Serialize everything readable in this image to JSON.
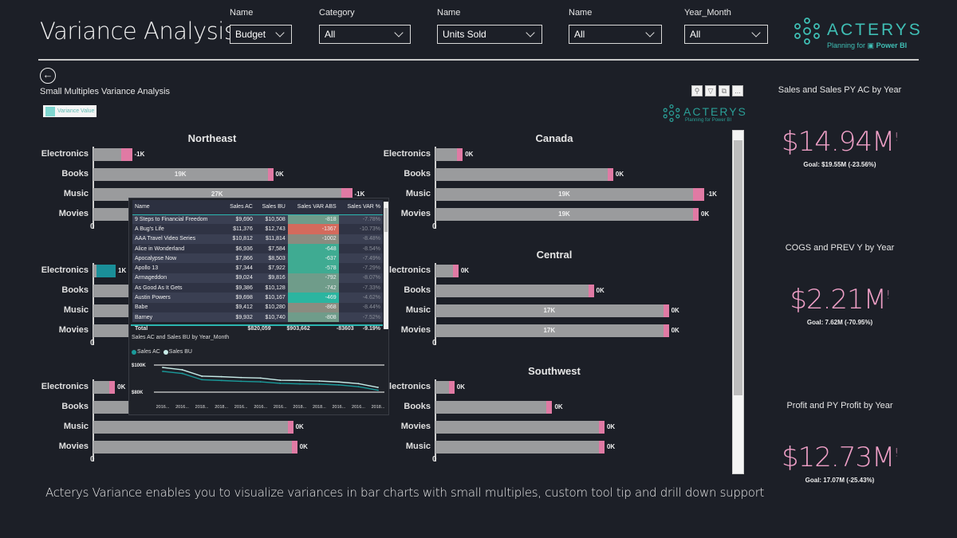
{
  "header": {
    "title": "Variance Analysis",
    "slicers": [
      {
        "label": "Name",
        "value": "Budget"
      },
      {
        "label": "Category",
        "value": "All"
      },
      {
        "label": "Name",
        "value": "Units Sold"
      },
      {
        "label": "Name",
        "value": "All"
      },
      {
        "label": "Year_Month",
        "value": "All"
      }
    ],
    "logo": {
      "name": "ACTERYS",
      "tagline_prefix": "Planning for",
      "tagline_product": "Power BI"
    }
  },
  "visual": {
    "title": "Small Multiples Variance Analysis",
    "legend": "Variance Value",
    "legend_color": "#7fd6cf",
    "toolbar_icons": [
      "pin-icon",
      "filter-icon",
      "focus-mode-icon",
      "more-options-icon"
    ],
    "more_label": "...",
    "watermark": {
      "name": "ACTERYS",
      "tagline": "Planning for Power BI"
    },
    "zero_label": "0",
    "colors": {
      "bar": "#9a9b9d",
      "negative_variance": "#e07aa4",
      "positive_variance": "#1a8f99"
    },
    "multiples": [
      {
        "title": "Northeast",
        "rows": [
          {
            "cat": "Electronics",
            "value": 3,
            "var_label": "-1K"
          },
          {
            "cat": "Books",
            "value": 19,
            "label": "19K",
            "var_label": "0K"
          },
          {
            "cat": "Music",
            "value": 27,
            "label": "27K",
            "var_label": "-1K"
          },
          {
            "cat": "Movies",
            "value": 20
          }
        ]
      },
      {
        "title": "Canada",
        "rows": [
          {
            "cat": "Electronics",
            "value": 1.6,
            "var_label": "0K"
          },
          {
            "cat": "Books",
            "value": 12.7,
            "var_label": "0K"
          },
          {
            "cat": "Music",
            "value": 19,
            "label": "19K",
            "var_label": "-1K"
          },
          {
            "cat": "Movies",
            "value": 19,
            "label": "19K",
            "var_label": "0K"
          }
        ]
      },
      {
        "title": "",
        "rows": [
          {
            "cat": "Electronics",
            "value": 1.4,
            "var_label": "1K",
            "positive": true
          },
          {
            "cat": "Books",
            "value": 10
          },
          {
            "cat": "Music",
            "value": 10
          },
          {
            "cat": "Movies",
            "value": 10
          }
        ]
      },
      {
        "title": "Central",
        "rows": [
          {
            "cat": "Electronics",
            "value": 1.3,
            "var_label": "0K"
          },
          {
            "cat": "Books",
            "value": 11.4,
            "var_label": "0K"
          },
          {
            "cat": "Music",
            "value": 17,
            "label": "17K",
            "var_label": "0K"
          },
          {
            "cat": "Movies",
            "value": 17,
            "label": "17K",
            "var_label": "0K"
          }
        ]
      },
      {
        "title": "",
        "rows": [
          {
            "cat": "Electronics",
            "value": 1.2,
            "var_label": "0K"
          },
          {
            "cat": "Books",
            "value": 10
          },
          {
            "cat": "Music",
            "value": 14.5,
            "var_label": "0K"
          },
          {
            "cat": "Movies",
            "value": 14.8,
            "var_label": "0K"
          }
        ]
      },
      {
        "title": "Southwest",
        "rows": [
          {
            "cat": "Electronics",
            "value": 1.0,
            "var_label": "0K"
          },
          {
            "cat": "Books",
            "value": 8.3,
            "var_label": "0K"
          },
          {
            "cat": "Movies",
            "value": 12.2,
            "var_label": "0K"
          },
          {
            "cat": "Music",
            "value": 12.2,
            "var_label": "0K"
          }
        ]
      }
    ]
  },
  "tooltip": {
    "table": {
      "columns": [
        "Name",
        "Sales AC",
        "Sales BU",
        "Sales VAR ABS",
        "Sales VAR %"
      ],
      "rows": [
        [
          "9 Steps to Financial Freedom",
          "$9,690",
          "$10,508",
          "-818",
          "-7.78%",
          "#6f9c8a"
        ],
        [
          "A Bug's Life",
          "$11,376",
          "$12,743",
          "-1367",
          "-10.73%",
          "#d46a5c"
        ],
        [
          "AAA Travel Video Series",
          "$10,812",
          "$11,814",
          "-1002",
          "-8.48%",
          "#8a8c80"
        ],
        [
          "Alice in Wonderland",
          "$6,936",
          "$7,584",
          "-648",
          "-8.54%",
          "#3fab92"
        ],
        [
          "Apocalypse Now",
          "$7,866",
          "$8,503",
          "-637",
          "-7.49%",
          "#3fab92"
        ],
        [
          "Apollo 13",
          "$7,344",
          "$7,922",
          "-578",
          "-7.29%",
          "#3fab92"
        ],
        [
          "Armageddon",
          "$9,024",
          "$9,816",
          "-792",
          "-8.07%",
          "#6f9c8a"
        ],
        [
          "As Good As It Gets",
          "$9,386",
          "$10,128",
          "-742",
          "-7.33%",
          "#6f9c8a"
        ],
        [
          "Austin Powers",
          "$9,698",
          "$10,167",
          "-469",
          "-4.62%",
          "#2bb5a0"
        ],
        [
          "Babe",
          "$9,412",
          "$10,280",
          "-868",
          "-8.44%",
          "#8a8c80"
        ],
        [
          "Barney",
          "$9,932",
          "$10,740",
          "-808",
          "-7.52%",
          "#6f9c8a"
        ]
      ],
      "total": [
        "Total",
        "$820,059",
        "$903,662",
        "-83603",
        "-9.19%"
      ]
    },
    "line_chart": {
      "title": "Sales AC and Sales BU by Year_Month",
      "chart_data": {
        "type": "line",
        "x": [
          "2016...",
          "2016...",
          "2018...",
          "2018...",
          "2016...",
          "2016...",
          "2016...",
          "2018...",
          "2018...",
          "2016...",
          "2016...",
          "2018..."
        ],
        "series": [
          {
            "name": "Sales AC",
            "color": "#1a9a9a",
            "values": [
              95.3,
              93.8,
              89.2,
              88.6,
              88.0,
              87.6,
              86.5,
              86.1,
              85.9,
              85.3,
              84.0,
              81.4
            ]
          },
          {
            "name": "Sales BU",
            "color": "#c8ece8",
            "values": [
              98.2,
              96.5,
              91.8,
              91.4,
              90.8,
              90.4,
              88.8,
              88.6,
              88.2,
              87.5,
              86.3,
              83.5
            ]
          }
        ],
        "y_unit": "K$",
        "yticks": [
          {
            "value": 100,
            "label": "$100K"
          },
          {
            "value": 80,
            "label": "$80K"
          }
        ],
        "ylim": [
          80,
          100
        ]
      }
    }
  },
  "kpis": [
    {
      "title": "Sales and Sales PY AC by Year",
      "value": "$14.94M",
      "flag": "!",
      "goal": "Goal: $19.55M (-23.56%)"
    },
    {
      "title": "COGS and PREV Y by Year",
      "value": "$2.21M",
      "flag": "!",
      "goal": "Goal: 7.62M (-70.95%)"
    },
    {
      "title": "Profit and PY Profit by Year",
      "value": "$12.73M",
      "flag": "!",
      "goal": "Goal: 17.07M (-25.43%)"
    }
  ],
  "footer": "Acterys Variance enables you to visualize variances in bar charts with small multiples, custom tool tip and drill down support"
}
